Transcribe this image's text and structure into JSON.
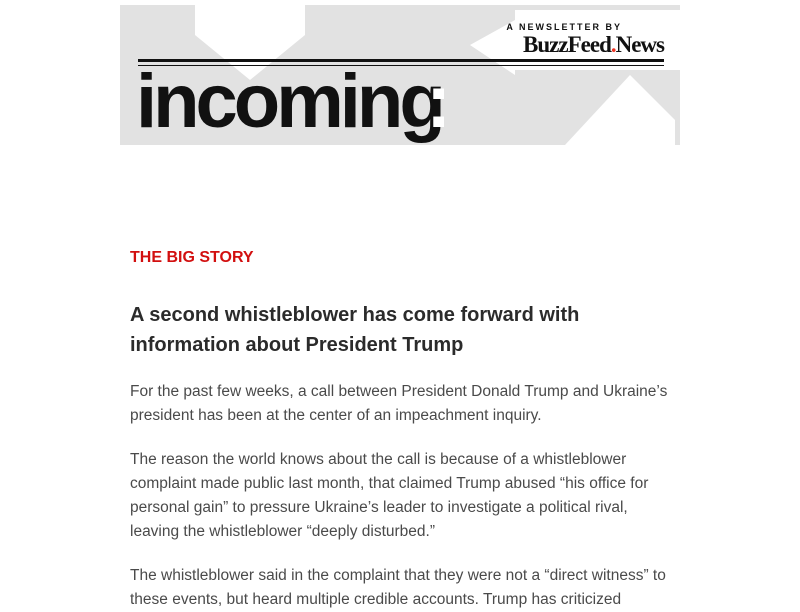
{
  "newsletter": {
    "tagline": "A NEWSLETTER BY",
    "brand_part1": "BuzzFeed",
    "brand_dot": ".",
    "brand_part2": "News",
    "wordmark": "incoming",
    "wordmark_colon": ":"
  },
  "story": {
    "kicker": "THE BIG STORY",
    "headline": "A second whistleblower has come forward with information about President Trump",
    "paragraphs": [
      "For the past few weeks, a call between President Donald Trump and Ukraine’s president has been at the center of an impeachment inquiry.",
      "The reason the world knows about the call is because of a whistleblower complaint made public last month, that claimed Trump abused “his office for personal gain” to pressure Ukraine’s leader to investigate a political rival, leaving the whistleblower “deeply disturbed.”",
      "The whistleblower said in the complaint that they were not a “direct witness” to these events, but heard multiple credible accounts. Trump has criticized"
    ]
  },
  "colors": {
    "header_bg": "#e2e2e2",
    "accent_red": "#d20f0f",
    "text_dark": "#2b2b2b",
    "text_body": "#4a4a4a"
  }
}
